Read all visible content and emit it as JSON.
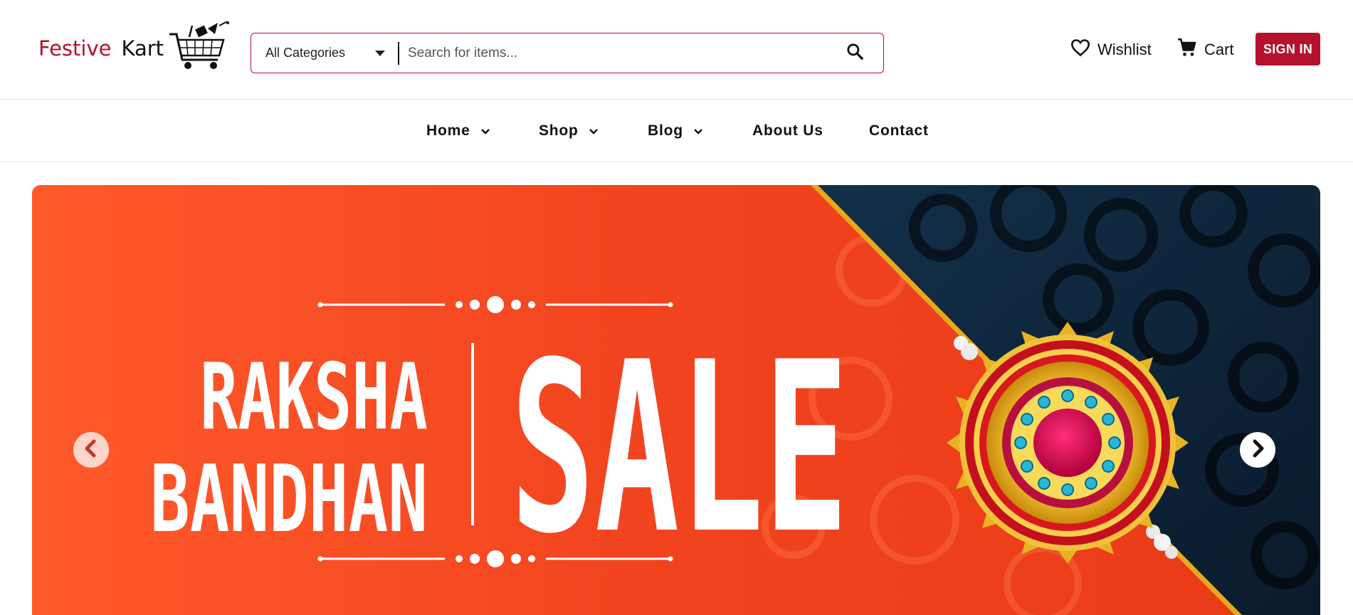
{
  "brand": {
    "word1": "Festive",
    "word2": "Kart"
  },
  "search": {
    "category_selected": "All Categories",
    "placeholder": "Search for items..."
  },
  "header": {
    "wishlist_label": "Wishlist",
    "cart_label": "Cart",
    "signin_label": "SIGN IN"
  },
  "nav": {
    "items": [
      {
        "label": "Home",
        "has_dropdown": true
      },
      {
        "label": "Shop",
        "has_dropdown": true
      },
      {
        "label": "Blog",
        "has_dropdown": true
      },
      {
        "label": "About Us",
        "has_dropdown": false
      },
      {
        "label": "Contact",
        "has_dropdown": false
      }
    ]
  },
  "banner": {
    "line1": "RAKSHA",
    "line2": "BANDHAN",
    "headline": "SALE"
  },
  "colors": {
    "accent": "#b5122e",
    "banner_orange": "#f2451f",
    "banner_dark": "#0f2438"
  },
  "icons": {
    "category_dropdown": "caret-down-icon",
    "search": "search-icon",
    "wishlist": "heart-icon",
    "cart": "cart-icon",
    "nav_dropdown": "chevron-down-icon",
    "carousel_prev": "chevron-left-icon",
    "carousel_next": "chevron-right-icon"
  }
}
